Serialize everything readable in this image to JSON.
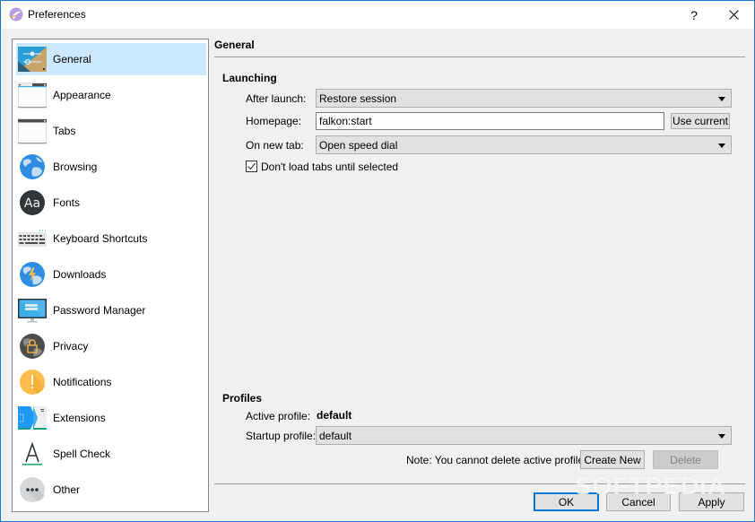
{
  "window": {
    "title": "Preferences",
    "help_label": "?",
    "close_label": "×"
  },
  "sidebar": {
    "items": [
      {
        "label": "General",
        "icon": "general-icon",
        "selected": true
      },
      {
        "label": "Appearance",
        "icon": "appearance-icon"
      },
      {
        "label": "Tabs",
        "icon": "tabs-icon"
      },
      {
        "label": "Browsing",
        "icon": "globe-icon"
      },
      {
        "label": "Fonts",
        "icon": "fonts-icon"
      },
      {
        "label": "Keyboard Shortcuts",
        "icon": "keyboard-icon"
      },
      {
        "label": "Downloads",
        "icon": "downloads-icon"
      },
      {
        "label": "Password Manager",
        "icon": "monitor-icon"
      },
      {
        "label": "Privacy",
        "icon": "lock-globe-icon"
      },
      {
        "label": "Notifications",
        "icon": "warning-icon"
      },
      {
        "label": "Extensions",
        "icon": "extensions-icon"
      },
      {
        "label": "Spell Check",
        "icon": "spell-check-icon"
      },
      {
        "label": "Other",
        "icon": "more-icon"
      }
    ]
  },
  "panel": {
    "title": "General",
    "launching": {
      "title": "Launching",
      "after_launch_label": "After launch:",
      "after_launch_value": "Restore session",
      "homepage_label": "Homepage:",
      "homepage_value": "falkon:start",
      "use_current_label": "Use current",
      "new_tab_label": "On new tab:",
      "new_tab_value": "Open speed dial",
      "dont_load_tabs_label": "Don't load tabs until selected",
      "dont_load_tabs_checked": true
    },
    "profiles": {
      "title": "Profiles",
      "active_label": "Active profile:",
      "active_value": "default",
      "startup_label": "Startup profile:",
      "startup_value": "default",
      "note": "Note: You cannot delete active profile.",
      "create_new_label": "Create New",
      "delete_label": "Delete"
    }
  },
  "buttons": {
    "ok": "OK",
    "cancel": "Cancel",
    "apply": "Apply"
  },
  "watermark": "SOFTPEDIA"
}
